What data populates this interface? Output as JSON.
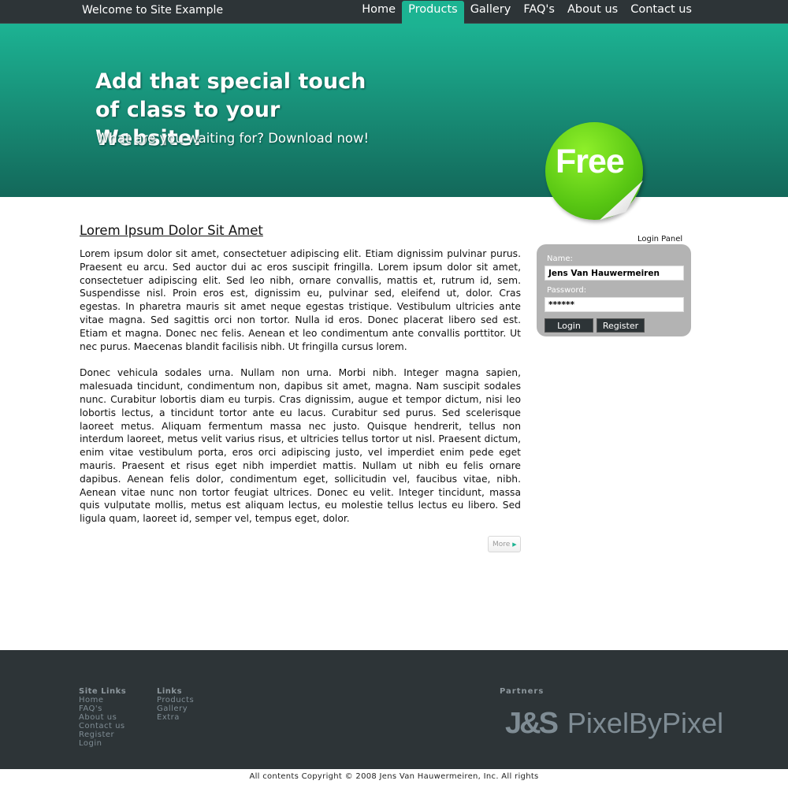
{
  "header": {
    "site_title": "Welcome to Site Example",
    "nav": [
      {
        "label": "Home"
      },
      {
        "label": "Products",
        "active": true
      },
      {
        "label": "Gallery"
      },
      {
        "label": "FAQ's"
      },
      {
        "label": "About us"
      },
      {
        "label": "Contact us"
      }
    ]
  },
  "hero": {
    "headline": "Add that special touch of class to your Website!",
    "subheadline": "What are you waiting for? Download now!",
    "badge": "Free"
  },
  "article": {
    "title": "Lorem Ipsum Dolor Sit Amet",
    "paragraphs": [
      "Lorem ipsum dolor sit amet, consectetuer adipiscing elit. Etiam dignissim pulvinar purus. Praesent eu arcu. Sed auctor dui ac eros suscipit fringilla. Lorem ipsum dolor sit amet, consectetuer adipiscing elit. Sed leo nibh, ornare convallis, mattis et, rutrum id, sem. Suspendisse nisl. Proin eros est, dignissim eu, pulvinar sed, eleifend ut, dolor. Cras egestas. In pharetra mauris sit amet neque egestas tristique. Vestibulum ultricies ante vitae magna. Sed sagittis orci non tortor. Nulla id eros. Donec placerat libero sed est. Etiam et magna. Donec nec felis. Aenean et leo condimentum ante convallis porttitor. Ut nec purus. Maecenas blandit facilisis nibh. Ut fringilla cursus lorem.",
      "Donec vehicula sodales urna. Nullam non urna. Morbi nibh. Integer magna sapien, malesuada tincidunt, condimentum non, dapibus sit amet, magna. Nam suscipit sodales nunc. Curabitur lobortis diam eu turpis. Cras dignissim, augue et tempor dictum, nisi leo lobortis lectus, a tincidunt tortor ante eu lacus. Curabitur sed purus. Sed scelerisque laoreet metus. Aliquam fermentum massa nec justo. Quisque hendrerit, tellus non interdum laoreet, metus velit varius risus, et ultricies tellus tortor ut nisl. Praesent dictum, enim vitae vestibulum porta, eros orci adipiscing justo, vel imperdiet enim pede eget mauris. Praesent et risus eget nibh imperdiet mattis. Nullam ut nibh eu felis ornare dapibus. Aenean felis dolor, condimentum eget, sollicitudin vel, faucibus vitae, nibh. Aenean vitae nunc non tortor feugiat ultrices. Donec eu velit. Integer tincidunt, massa quis vulputate mollis, metus est aliquam lectus, eu molestie tellus lectus eu libero. Sed ligula quam, laoreet id, semper vel, tempus eget, dolor."
    ],
    "more_label": "More"
  },
  "login": {
    "panel_label": "Login Panel",
    "name_label": "Name:",
    "name_value": "Jens Van Hauwermeiren",
    "password_label": "Password:",
    "password_value": "******",
    "login_button": "Login",
    "register_button": "Register"
  },
  "footer": {
    "site_links": {
      "heading": "Site Links",
      "items": [
        "Home",
        "FAQ's",
        "About us",
        "Contact us",
        "Register",
        "Login"
      ]
    },
    "links": {
      "heading": "Links",
      "items": [
        "Products",
        "Gallery",
        "Extra"
      ]
    },
    "partners": {
      "heading": "Partners",
      "logo_mark": "J&S",
      "logo_text": "PixelByPixel"
    },
    "copyright": "All contents Copyright © 2008 Jens Van Hauwermeiren, Inc. All rights"
  },
  "colors": {
    "accent": "#1cb392",
    "dark": "#2d3437",
    "badge": "#58c613"
  }
}
